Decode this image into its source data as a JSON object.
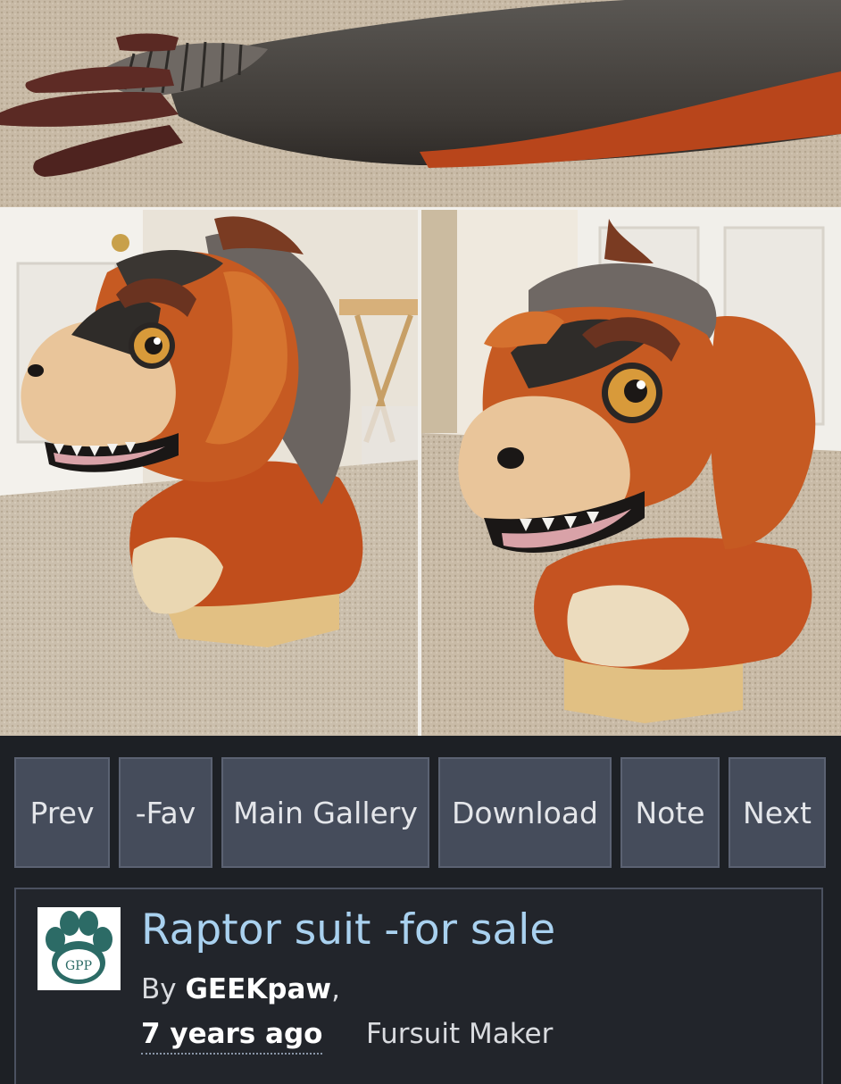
{
  "photos": {
    "top": "tail photo",
    "left": "head side view photo",
    "right": "head three-quarter view photo"
  },
  "nav": {
    "prev": "Prev",
    "fav": "-Fav",
    "main_gallery": "Main Gallery",
    "download": "Download",
    "note": "Note",
    "next": "Next"
  },
  "submission": {
    "title": "Raptor suit -for sale",
    "by_prefix": "By",
    "author": "GEEKpaw",
    "by_suffix": ",",
    "posted": "7 years ago",
    "category": "Fursuit Maker",
    "avatar_text": "GPP"
  },
  "colors": {
    "background": "#1d2025",
    "button": "#454c5b",
    "title": "#a9d1ef",
    "avatar_paw": "#2c6b66"
  },
  "icons": {
    "avatar": "paw-logo-icon"
  }
}
